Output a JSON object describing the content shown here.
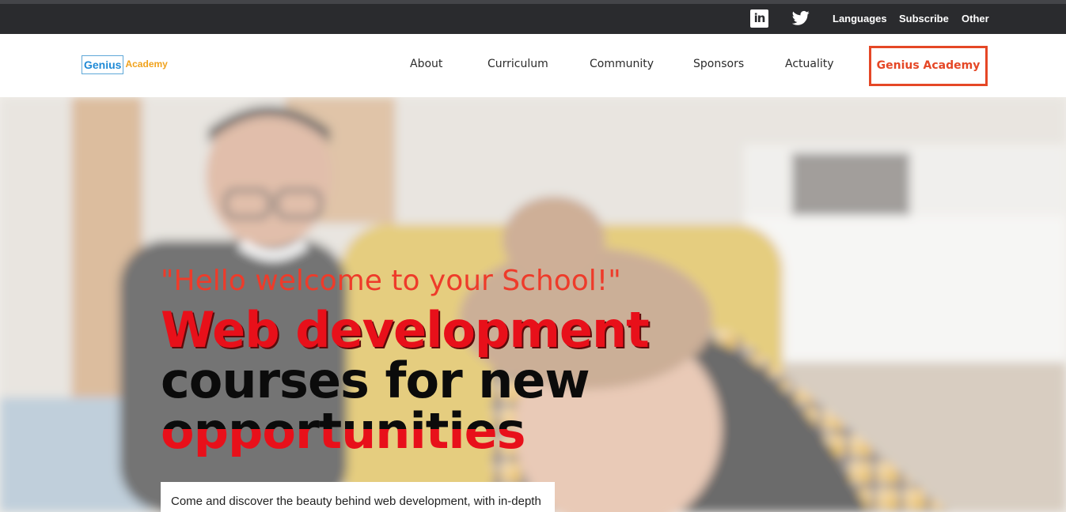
{
  "topbar": {
    "linkedin_icon": "linkedin-icon",
    "twitter_icon": "twitter-icon",
    "links": [
      {
        "label": "Languages"
      },
      {
        "label": "Subscribe"
      },
      {
        "label": "Other"
      }
    ]
  },
  "header": {
    "logo": {
      "part1": "Genius",
      "part2": "Academy"
    },
    "nav": [
      {
        "label": "About"
      },
      {
        "label": "Curriculum"
      },
      {
        "label": "Community"
      },
      {
        "label": "Sponsors"
      },
      {
        "label": "Actuality"
      }
    ],
    "cta_label": "Genius Academy"
  },
  "hero": {
    "tagline": "\"Hello welcome to your School!\"",
    "headline": {
      "line1": "Web development",
      "line2": "courses for new",
      "line3": "opportunities"
    },
    "intro": "Come and discover the beauty behind web development, with in-depth training around the different technologies that make it..."
  },
  "colors": {
    "accent": "#e54726",
    "headline_red": "#e8101a",
    "topbar_bg": "#2a2b2e",
    "logo_blue": "#1f8ad6",
    "logo_orange": "#f0a21c"
  }
}
